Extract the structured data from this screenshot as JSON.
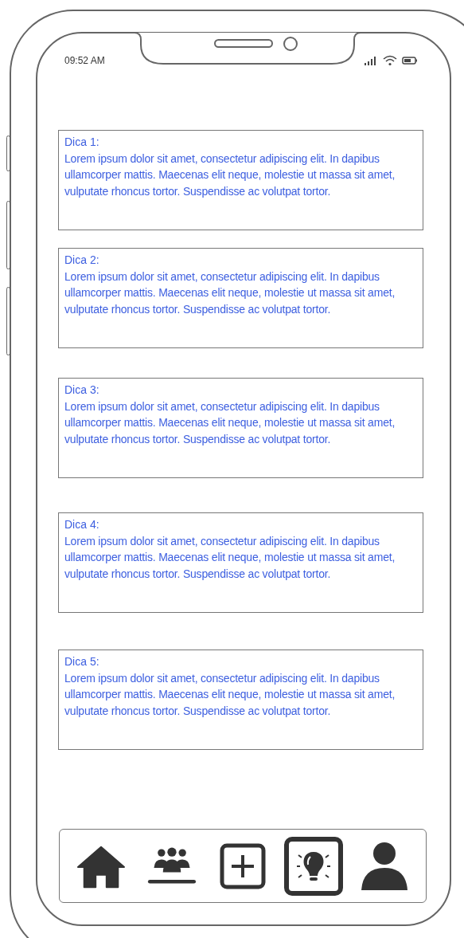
{
  "status_bar": {
    "time": "09:52 AM"
  },
  "tips": [
    {
      "title": "Dica 1:",
      "text": "Lorem ipsum dolor sit amet, consectetur adipiscing elit. In dapibus ullamcorper mattis. Maecenas elit neque, molestie ut massa sit amet, vulputate rhoncus tortor. Suspendisse ac volutpat tortor."
    },
    {
      "title": "Dica 2:",
      "text": "Lorem ipsum dolor sit amet, consectetur adipiscing elit. In dapibus ullamcorper mattis. Maecenas elit neque, molestie ut massa sit amet, vulputate rhoncus tortor. Suspendisse ac volutpat tortor."
    },
    {
      "title": "Dica 3:",
      "text": "Lorem ipsum dolor sit amet, consectetur adipiscing elit. In dapibus ullamcorper mattis. Maecenas elit neque, molestie ut massa sit amet, vulputate rhoncus tortor. Suspendisse ac volutpat tortor."
    },
    {
      "title": "Dica 4:",
      "text": "Lorem ipsum dolor sit amet, consectetur adipiscing elit. In dapibus ullamcorper mattis. Maecenas elit neque, molestie ut massa sit amet, vulputate rhoncus tortor. Suspendisse ac volutpat tortor."
    },
    {
      "title": "Dica 5:",
      "text": "Lorem ipsum dolor sit amet, consectetur adipiscing elit. In dapibus ullamcorper mattis. Maecenas elit neque, molestie ut massa sit amet, vulputate rhoncus tortor. Suspendisse ac volutpat tortor."
    }
  ],
  "nav": [
    {
      "kind": "home",
      "selected": false
    },
    {
      "kind": "group",
      "selected": false
    },
    {
      "kind": "add",
      "selected": false
    },
    {
      "kind": "tips",
      "selected": true
    },
    {
      "kind": "profile",
      "selected": false
    }
  ]
}
